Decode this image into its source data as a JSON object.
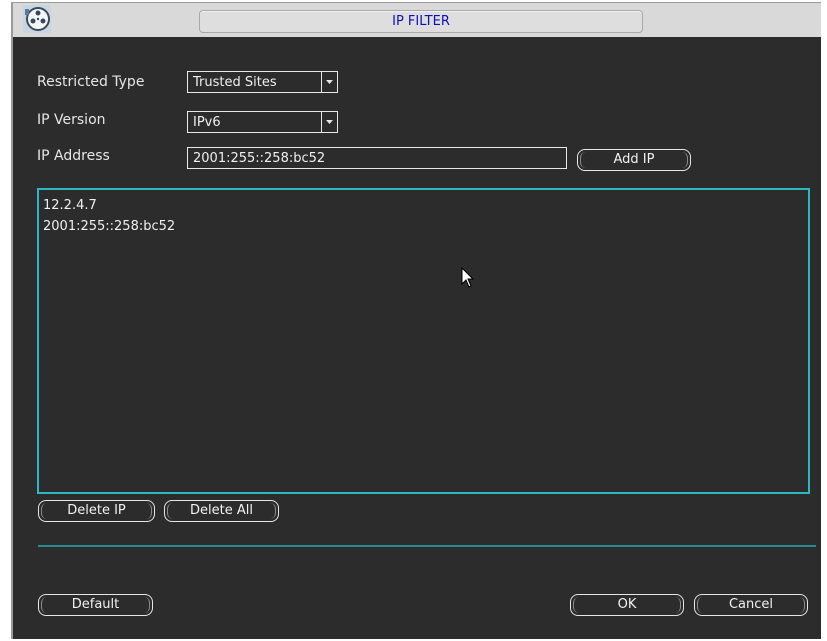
{
  "window": {
    "title": "IP FILTER",
    "app_icon": "film-reel-icon"
  },
  "form": {
    "restricted_type": {
      "label": "Restricted Type",
      "value": "Trusted Sites"
    },
    "ip_version": {
      "label": "IP Version",
      "value": "IPv6"
    },
    "ip_address": {
      "label": "IP Address",
      "value": "2001:255::258:bc52"
    }
  },
  "buttons": {
    "add_ip": "Add IP",
    "delete_ip": "Delete IP",
    "delete_all": "Delete All",
    "default": "Default",
    "ok": "OK",
    "cancel": "Cancel"
  },
  "ip_list": [
    "12.2.4.7",
    "2001:255::258:bc52"
  ],
  "colors": {
    "background": "#2c2c2c",
    "title_text": "#1010b8",
    "list_border": "#2bb8c3",
    "divider": "#2b8b95"
  },
  "icons": {
    "dropdown": "chevron-down-icon",
    "cursor": "mouse-pointer-icon"
  }
}
